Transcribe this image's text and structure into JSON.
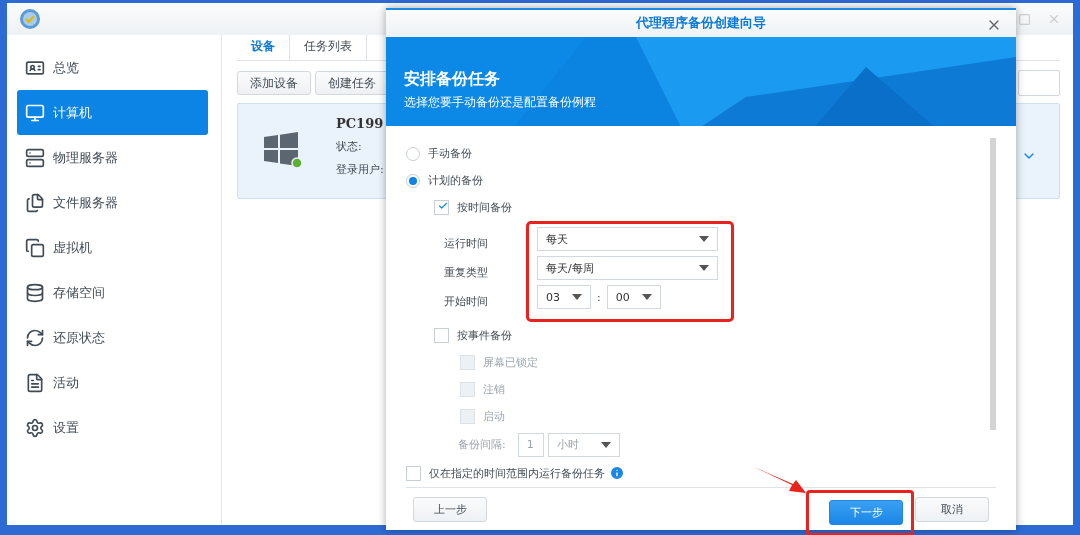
{
  "app": {
    "sidebar": [
      {
        "label": "总览",
        "selected": false
      },
      {
        "label": "计算机",
        "selected": true
      },
      {
        "label": "物理服务器",
        "selected": false
      },
      {
        "label": "文件服务器",
        "selected": false
      },
      {
        "label": "虚拟机",
        "selected": false
      },
      {
        "label": "存储空间",
        "selected": false
      },
      {
        "label": "还原状态",
        "selected": false
      },
      {
        "label": "活动",
        "selected": false
      },
      {
        "label": "设置",
        "selected": false
      }
    ],
    "tabs": [
      {
        "label": "设备",
        "selected": true
      },
      {
        "label": "任务列表",
        "selected": false
      }
    ],
    "toolbar": [
      "添加设备",
      "创建任务"
    ],
    "device": {
      "name": "PC199",
      "status_label": "状态:",
      "user_label": "登录用户:",
      "online": true
    }
  },
  "dialog": {
    "title": "代理程序备份创建向导",
    "heading": "安排备份任务",
    "subheading": "选择您要手动备份还是配置备份例程",
    "modes": [
      {
        "label": "手动备份",
        "selected": false
      },
      {
        "label": "计划的备份",
        "selected": true
      }
    ],
    "time_backup": {
      "label": "按时间备份",
      "checked": true,
      "fields": [
        {
          "label": "运行时间",
          "kind": "select",
          "value": "每天"
        },
        {
          "label": "重复类型",
          "kind": "select",
          "value": "每天/每周"
        },
        {
          "label": "开始时间",
          "kind": "time",
          "hour": "03",
          "separator": ":",
          "minute": "00"
        }
      ]
    },
    "event_backup": {
      "label": "按事件备份",
      "checked": false,
      "events": [
        {
          "label": "屏幕已锁定",
          "checked": false,
          "disabled": true
        },
        {
          "label": "注销",
          "checked": false,
          "disabled": true
        },
        {
          "label": "启动",
          "checked": false,
          "disabled": true
        }
      ],
      "interval": {
        "label": "备份间隔:",
        "value": "1",
        "unit": "小时",
        "disabled": true
      }
    },
    "time_range": {
      "label": "仅在指定的时间范围内运行备份任务",
      "checked": false
    },
    "buttons": [
      {
        "label": "上一步",
        "kind": "back"
      },
      {
        "label": "下一步",
        "kind": "primary"
      },
      {
        "label": "取消",
        "kind": "cancel"
      }
    ]
  }
}
